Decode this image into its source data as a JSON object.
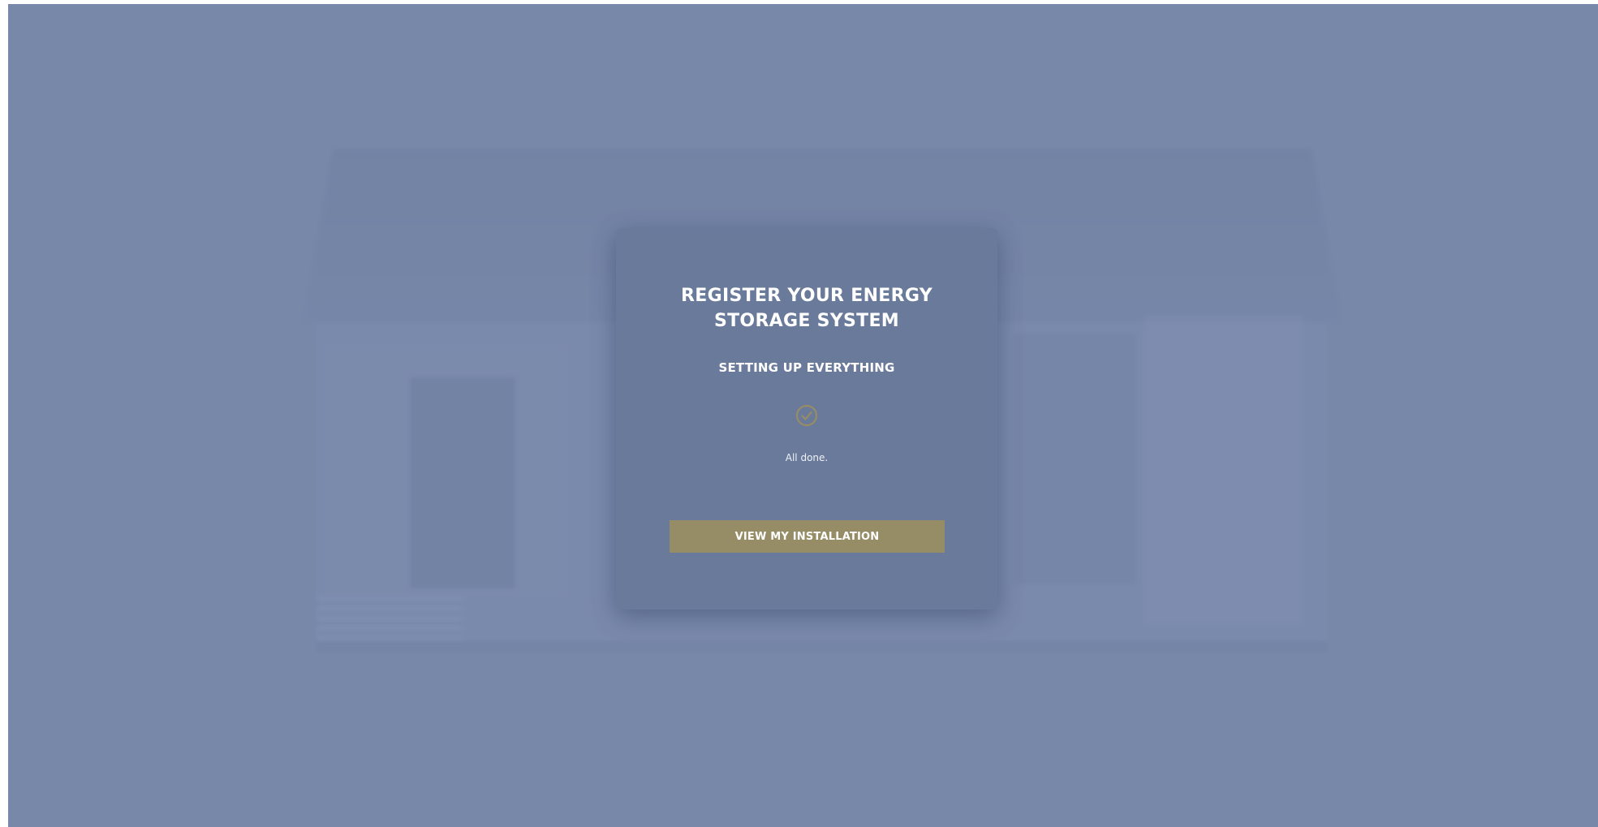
{
  "modal": {
    "title_line1": "REGISTER YOUR ENERGY",
    "title_line2": "STORAGE SYSTEM",
    "subtitle": "SETTING UP EVERYTHING",
    "status_icon": "check-circle-icon",
    "status_text": "All done.",
    "button_label": "VIEW MY INSTALLATION"
  },
  "colors": {
    "overlay": "#7888a8",
    "modal_background": "#6a7a9a",
    "accent": "#968c66",
    "text": "#ffffff"
  }
}
